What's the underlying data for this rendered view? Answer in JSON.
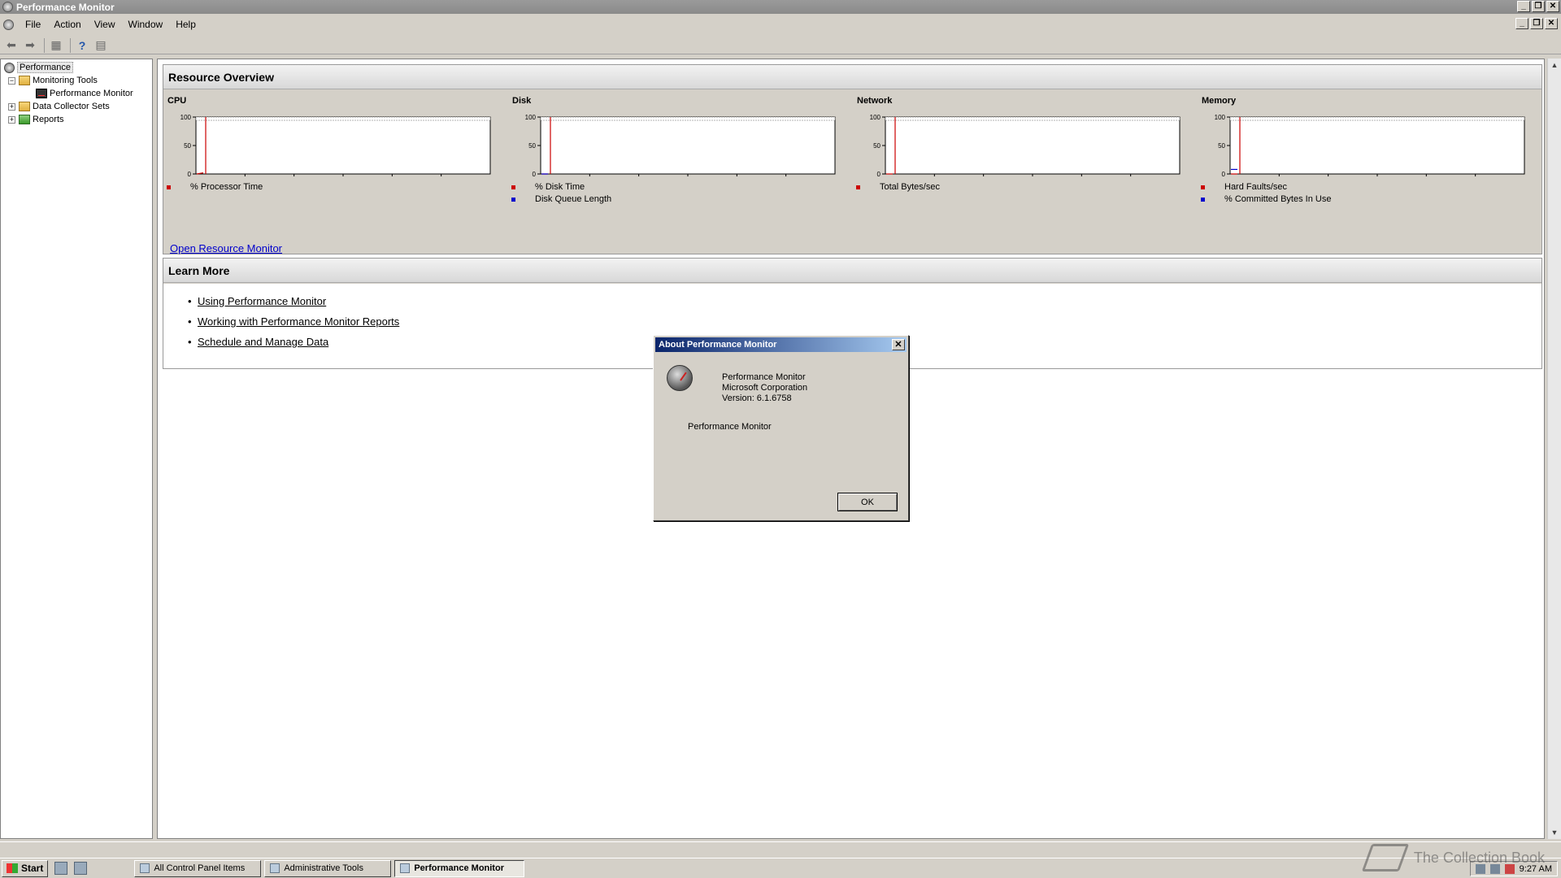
{
  "window": {
    "title": "Performance Monitor"
  },
  "menu": [
    "File",
    "Action",
    "View",
    "Window",
    "Help"
  ],
  "tree": {
    "root": "Performance",
    "items": [
      {
        "label": "Monitoring Tools",
        "expander": "−"
      },
      {
        "label": "Performance Monitor"
      },
      {
        "label": "Data Collector Sets",
        "expander": "+"
      },
      {
        "label": "Reports",
        "expander": "+"
      }
    ]
  },
  "resource_overview": {
    "title": "Resource Overview",
    "link": "Open Resource Monitor",
    "y_ticks": [
      "100",
      "50",
      "0"
    ]
  },
  "chart_data": [
    {
      "type": "line",
      "title": "CPU",
      "ylim": [
        0,
        100
      ],
      "series": [
        {
          "name": "% Processor Time",
          "color": "#cc0000",
          "values": [
            0,
            2
          ]
        }
      ]
    },
    {
      "type": "line",
      "title": "Disk",
      "ylim": [
        0,
        100
      ],
      "series": [
        {
          "name": "% Disk Time",
          "color": "#cc0000",
          "values": [
            0,
            0
          ]
        },
        {
          "name": "Disk Queue Length",
          "color": "#0000cc",
          "values": [
            0,
            0
          ]
        }
      ]
    },
    {
      "type": "line",
      "title": "Network",
      "ylim": [
        0,
        100
      ],
      "series": [
        {
          "name": "Total Bytes/sec",
          "color": "#cc0000",
          "values": [
            0,
            0
          ]
        }
      ]
    },
    {
      "type": "line",
      "title": "Memory",
      "ylim": [
        0,
        100
      ],
      "series": [
        {
          "name": "Hard Faults/sec",
          "color": "#cc0000",
          "values": [
            0,
            0
          ]
        },
        {
          "name": "% Committed Bytes In Use",
          "color": "#0000cc",
          "values": [
            8,
            8
          ]
        }
      ]
    }
  ],
  "learn_more": {
    "title": "Learn More",
    "links": [
      "Using Performance Monitor",
      "Working with Performance Monitor Reports",
      "Schedule and Manage Data"
    ]
  },
  "dialog": {
    "title": "About Performance Monitor",
    "product": "Performance Monitor",
    "company": "Microsoft Corporation",
    "version": "Version: 6.1.6758",
    "description": "Performance Monitor",
    "ok": "OK"
  },
  "taskbar": {
    "start": "Start",
    "tasks": [
      "All Control Panel Items",
      "Administrative Tools",
      "Performance Monitor"
    ],
    "clock": "9:27 AM"
  },
  "watermark": "The Collection Book"
}
